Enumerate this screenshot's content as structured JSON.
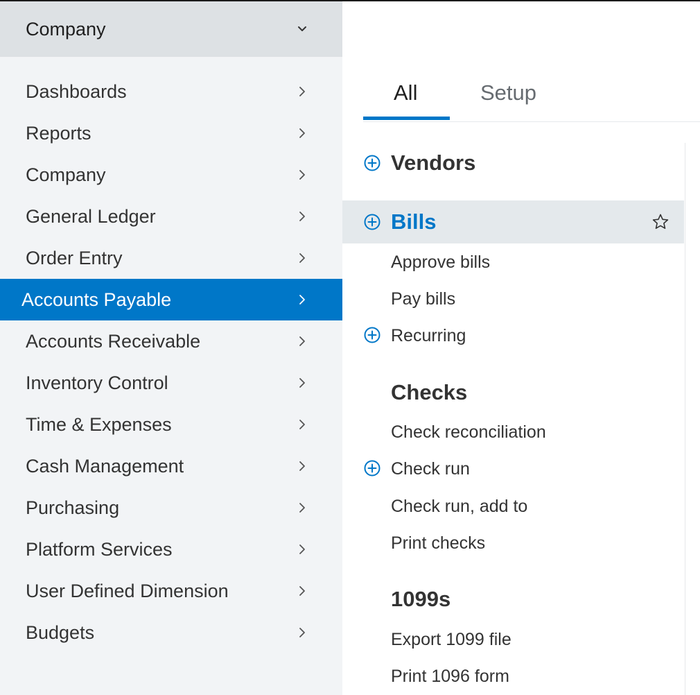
{
  "sidebar": {
    "header": {
      "title": "Company"
    },
    "items": [
      {
        "label": "Dashboards"
      },
      {
        "label": "Reports"
      },
      {
        "label": "Company"
      },
      {
        "label": "General Ledger"
      },
      {
        "label": "Order Entry"
      },
      {
        "label": "Accounts Payable",
        "active": true
      },
      {
        "label": "Accounts Receivable"
      },
      {
        "label": "Inventory Control"
      },
      {
        "label": "Time & Expenses"
      },
      {
        "label": "Cash Management"
      },
      {
        "label": "Purchasing"
      },
      {
        "label": "Platform Services"
      },
      {
        "label": "User Defined Dimension"
      },
      {
        "label": "Budgets"
      }
    ]
  },
  "tabs": {
    "all": "All",
    "setup": "Setup",
    "active": "All"
  },
  "menu": {
    "vendors": "Vendors",
    "bills": "Bills",
    "approve_bills": "Approve bills",
    "pay_bills": "Pay bills",
    "recurring": "Recurring",
    "checks": "Checks",
    "check_reconciliation": "Check reconciliation",
    "check_run": "Check run",
    "check_run_add_to": "Check run, add to",
    "print_checks": "Print checks",
    "forms_1099": "1099s",
    "export_1099_file": "Export 1099 file",
    "print_1096_form": "Print 1096 form"
  },
  "colors": {
    "accent": "#0077c8",
    "sidebar_bg": "#f2f4f6",
    "sidebar_header_bg": "#dde1e4",
    "highlight_row_bg": "#e4e9ec"
  },
  "icons": {
    "expand": "plus-circle-icon",
    "chevron": "chevron-right-icon",
    "dropdown": "chevron-down-icon",
    "favorite": "star-icon"
  }
}
